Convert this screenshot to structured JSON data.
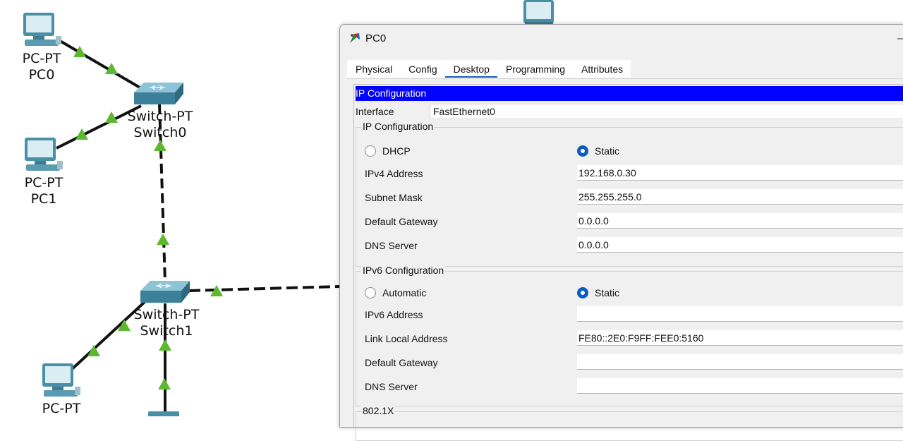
{
  "topology": {
    "devices": [
      {
        "id": "pc0",
        "labels": [
          "PC-PT",
          "PC0"
        ]
      },
      {
        "id": "pc1",
        "labels": [
          "PC-PT",
          "PC1"
        ]
      },
      {
        "id": "switch0",
        "labels": [
          "Switch-PT",
          "Switch0"
        ]
      },
      {
        "id": "switch1",
        "labels": [
          "Switch-PT",
          "Switch1"
        ]
      },
      {
        "id": "pc-bottom",
        "labels": [
          "PC-PT"
        ]
      }
    ],
    "colors": {
      "link": "#111111",
      "link_up": "#5cb82e",
      "pc_body": "#4a8fa8",
      "switch_body": "#4f93ad"
    }
  },
  "window": {
    "title": "PC0",
    "tabs": [
      "Physical",
      "Config",
      "Desktop",
      "Programming",
      "Attributes"
    ],
    "active_tab": "Desktop",
    "header": "IP Configuration",
    "interface_label": "Interface",
    "interface_value": "FastEthernet0",
    "ipv4": {
      "group_title": "IP Configuration",
      "dhcp_label": "DHCP",
      "static_label": "Static",
      "selected": "Static",
      "fields": [
        {
          "label": "IPv4 Address",
          "value": "192.168.0.30"
        },
        {
          "label": "Subnet Mask",
          "value": "255.255.255.0"
        },
        {
          "label": "Default Gateway",
          "value": "0.0.0.0"
        },
        {
          "label": "DNS Server",
          "value": "0.0.0.0"
        }
      ]
    },
    "ipv6": {
      "group_title": "IPv6 Configuration",
      "auto_label": "Automatic",
      "static_label": "Static",
      "selected": "Static",
      "fields": [
        {
          "label": "IPv6 Address",
          "value": ""
        },
        {
          "label": "Link Local Address",
          "value": "FE80::2E0:F9FF:FEE0:5160"
        },
        {
          "label": "Default Gateway",
          "value": ""
        },
        {
          "label": "DNS Server",
          "value": ""
        }
      ]
    },
    "dot1x_title": "802.1X",
    "colors": {
      "header_bg": "#0000ff",
      "radio_checked": "#0b5cc1",
      "tab_underline": "#1a5fb4"
    }
  }
}
